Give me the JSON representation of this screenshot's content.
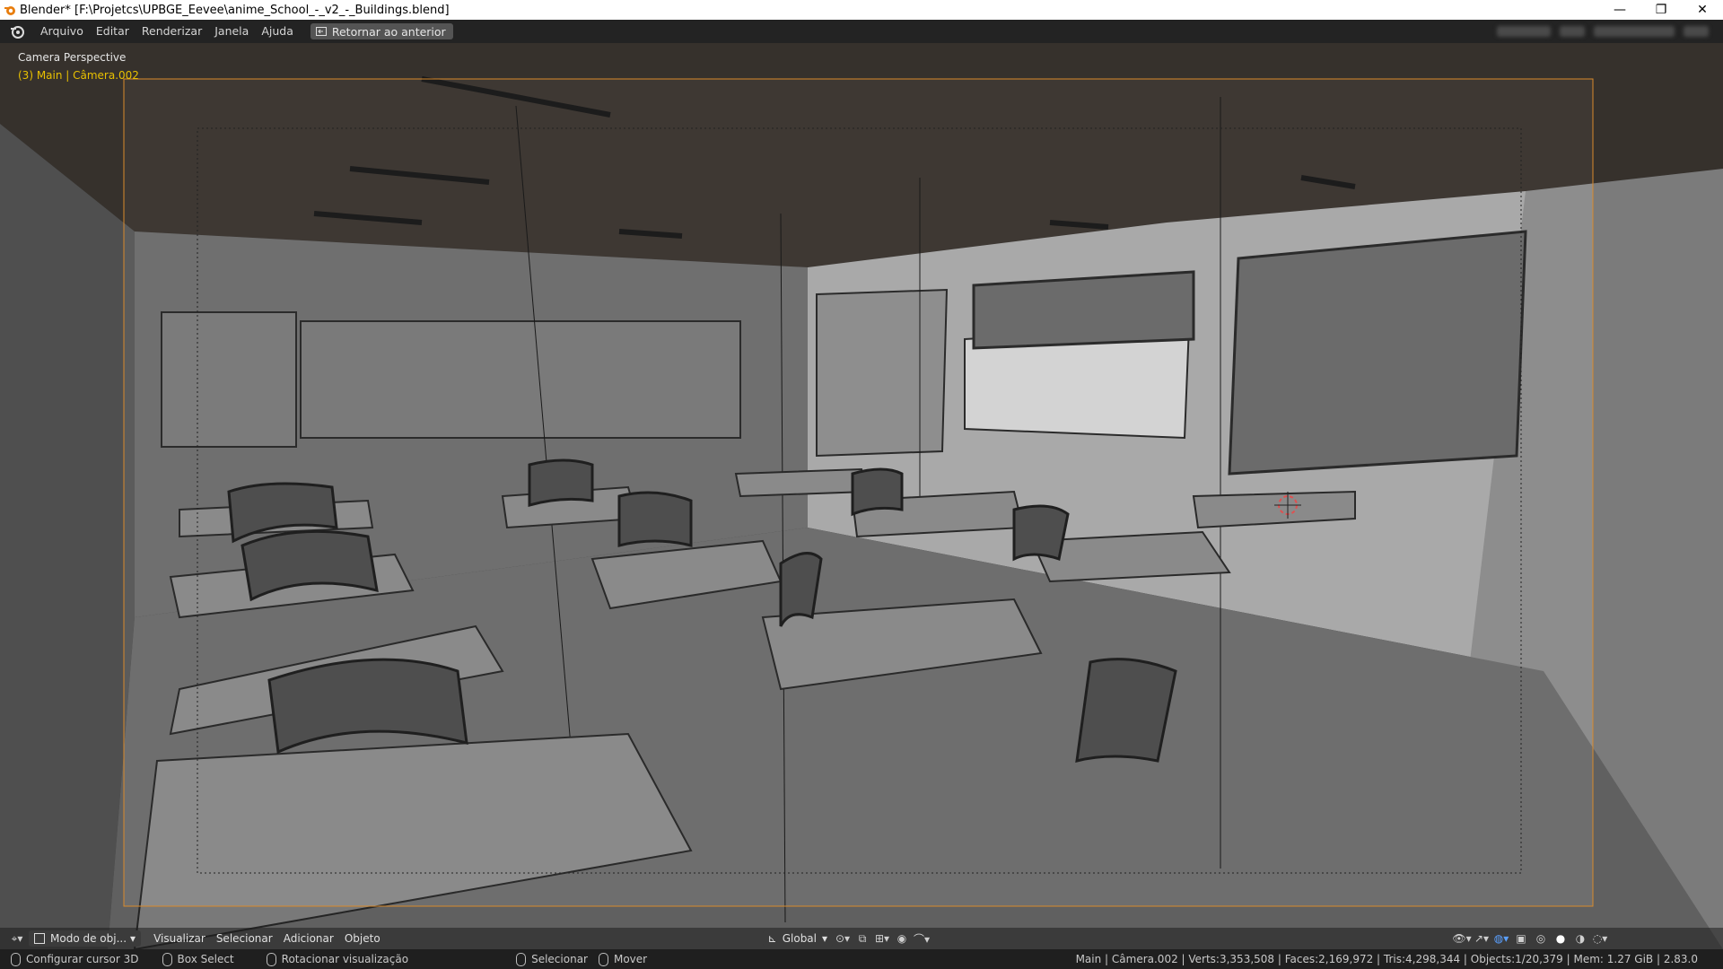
{
  "window": {
    "title": "Blender* [F:\\Projetcs\\UPBGE_Eevee\\anime_School_-_v2_-_Buildings.blend]",
    "minimize_glyph": "—",
    "maximize_glyph": "❐",
    "close_glyph": "✕"
  },
  "menubar": {
    "items": [
      "Arquivo",
      "Editar",
      "Renderizar",
      "Janela",
      "Ajuda"
    ],
    "back_button_label": "Retornar ao anterior"
  },
  "viewport": {
    "view_label": "Camera Perspective",
    "collection_label": "(3) Main | Câmera.002",
    "collection_color": "#e8c000",
    "camera_frame_color": "#d98a2b"
  },
  "viewport_header": {
    "mode_label": "Modo de obj...",
    "menus": [
      "Visualizar",
      "Selecionar",
      "Adicionar",
      "Objeto"
    ],
    "transform_orientation": "Global"
  },
  "statusbar": {
    "items": [
      {
        "label": "Configurar cursor 3D"
      },
      {
        "label": "Box Select"
      },
      {
        "label": "Rotacionar visualização"
      },
      {
        "label": "Selecionar"
      },
      {
        "label": "Mover"
      }
    ],
    "scene_stats": "Main | Câmera.002 | Verts:3,353,508 | Faces:2,169,972 | Tris:4,298,344 | Objects:1/20,379 | Mem: 1.27 GiB | 2.83.0"
  },
  "icons": {
    "app": "blender-icon",
    "back": "back-arrow-icon",
    "mouse": "mouse-icon"
  }
}
